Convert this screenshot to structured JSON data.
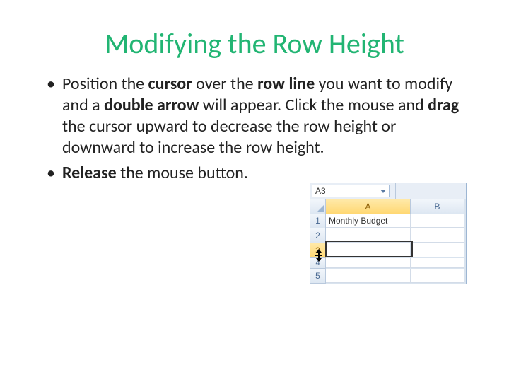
{
  "title": "Modifying the Row Height",
  "bullets": [
    {
      "segments": [
        {
          "t": "Position the ",
          "b": false
        },
        {
          "t": "cursor",
          "b": true
        },
        {
          "t": " over the ",
          "b": false
        },
        {
          "t": "row line",
          "b": true
        },
        {
          "t": " you want to modify and a ",
          "b": false
        },
        {
          "t": "double arrow",
          "b": true
        },
        {
          "t": " will appear. Click the mouse and ",
          "b": false
        },
        {
          "t": "drag",
          "b": true
        },
        {
          "t": " the cursor upward to decrease the row height or downward to increase the row height.",
          "b": false
        }
      ]
    },
    {
      "segments": [
        {
          "t": "Release",
          "b": true
        },
        {
          "t": " the mouse button.",
          "b": false
        }
      ]
    }
  ],
  "excel": {
    "name_box": "A3",
    "columns": [
      "A",
      "B"
    ],
    "active_column_index": 0,
    "rows": [
      {
        "num": "1",
        "cells": [
          "Monthly Budget",
          ""
        ],
        "h": "normal"
      },
      {
        "num": "2",
        "cells": [
          "",
          ""
        ],
        "h": "normal"
      },
      {
        "num": "3",
        "cells": [
          "",
          ""
        ],
        "h": "normal",
        "active": true
      },
      {
        "num": "4",
        "cells": [
          "",
          ""
        ],
        "h": "small"
      },
      {
        "num": "5",
        "cells": [
          "",
          ""
        ],
        "h": "normal"
      }
    ],
    "resize_cursor_icon": "row-resize-icon"
  }
}
